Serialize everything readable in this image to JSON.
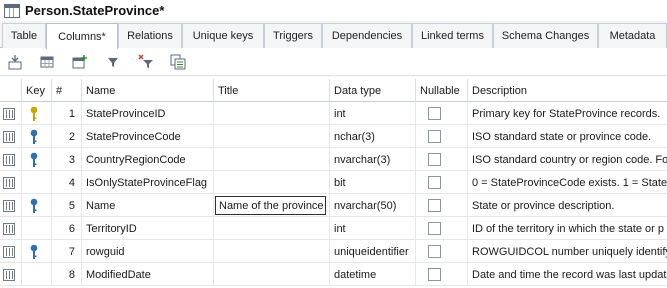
{
  "window": {
    "title": "Person.StateProvince*"
  },
  "tabs": [
    {
      "label": "Table"
    },
    {
      "label": "Columns*"
    },
    {
      "label": "Relations"
    },
    {
      "label": "Unique keys"
    },
    {
      "label": "Triggers"
    },
    {
      "label": "Dependencies"
    },
    {
      "label": "Linked terms"
    },
    {
      "label": "Schema Changes"
    },
    {
      "label": "Metadata"
    }
  ],
  "toolbar": {
    "icons": [
      "import-icon",
      "table-icon",
      "add-column-icon",
      "filter-icon",
      "clear-filter-icon",
      "copy-icon"
    ]
  },
  "grid": {
    "headers": {
      "key": "Key",
      "num": "#",
      "name": "Name",
      "title": "Title",
      "datatype": "Data type",
      "nullable": "Nullable",
      "description": "Description"
    },
    "rows": [
      {
        "key": "primary",
        "num": "1",
        "name": "StateProvinceID",
        "title": "",
        "datatype": "int",
        "nullable": false,
        "description": "Primary key for StateProvince records."
      },
      {
        "key": "unique",
        "num": "2",
        "name": "StateProvinceCode",
        "title": "",
        "datatype": "nchar(3)",
        "nullable": false,
        "description": "ISO standard state or province code."
      },
      {
        "key": "unique",
        "num": "3",
        "name": "CountryRegionCode",
        "title": "",
        "datatype": "nvarchar(3)",
        "nullable": false,
        "description": "ISO standard country or region code. Fo"
      },
      {
        "key": "",
        "num": "4",
        "name": "IsOnlyStateProvinceFlag",
        "title": "",
        "datatype": "bit",
        "nullable": false,
        "description": "0 = StateProvinceCode exists. 1 = State"
      },
      {
        "key": "unique",
        "num": "5",
        "name": "Name",
        "title": "Name of the province",
        "datatype": "nvarchar(50)",
        "nullable": false,
        "description": "State or province description."
      },
      {
        "key": "",
        "num": "6",
        "name": "TerritoryID",
        "title": "",
        "datatype": "int",
        "nullable": false,
        "description": "ID of the territory in which the state or p"
      },
      {
        "key": "unique",
        "num": "7",
        "name": "rowguid",
        "title": "",
        "datatype": "uniqueidentifier",
        "nullable": false,
        "description": "ROWGUIDCOL number uniquely identifyi"
      },
      {
        "key": "",
        "num": "8",
        "name": "ModifiedDate",
        "title": "",
        "datatype": "datetime",
        "nullable": false,
        "description": "Date and time the record was last updat"
      }
    ]
  },
  "colors": {
    "primary_key": "#c9a800",
    "unique_key": "#2f6fb3",
    "accent": "#b9c2cc"
  }
}
